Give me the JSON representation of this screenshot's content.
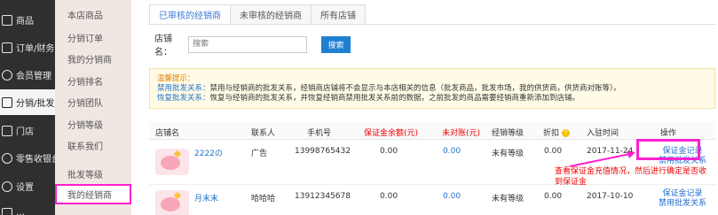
{
  "left_nav": [
    {
      "label": "商品",
      "icon": "shopping-bag-icon"
    },
    {
      "label": "订单/财务",
      "icon": "document-icon"
    },
    {
      "label": "会员管理",
      "icon": "user-icon"
    },
    {
      "label": "分销/批发",
      "icon": "distribute-icon",
      "active": true
    },
    {
      "label": "门店",
      "icon": "store-icon"
    },
    {
      "label": "零售收银台",
      "icon": "cashier-icon"
    },
    {
      "label": "设置",
      "icon": "gear-icon"
    },
    {
      "label": "…",
      "icon": "more-icon"
    }
  ],
  "sub_nav": [
    "本店商品",
    "分销订单",
    "我的分销商",
    "分销排名",
    "分销团队",
    "分销等级",
    "联系我们",
    "批发等级",
    "我的经销商"
  ],
  "tabs": [
    "已审核的经销商",
    "未审核的经销商",
    "所有店铺"
  ],
  "search": {
    "label": "店铺名：",
    "placeholder": "搜索",
    "button": "搜索"
  },
  "tip": {
    "title": "温馨提示：",
    "line1_key": "禁用批发关系：",
    "line1_text": "禁用与经销商的批发关系，经销商店铺将不会显示与本店相关的信息（批发商品，批发市场，我的供货商，供货商对账等）。",
    "line2_key": "恢复批发关系：",
    "line2_text": "恢复与经销商的批发关系，并恢复经销商禁用批发关系前的数据，之前批发的商品需要经销商重新添加到店铺。"
  },
  "table": {
    "headers": [
      "店铺名",
      "联系人",
      "手机号",
      "保证金余额(元)",
      "未对账(元)",
      "经销等级",
      "折扣",
      "入驻时间",
      "操作"
    ],
    "rows": [
      {
        "shop": "2222の",
        "contact": "广告",
        "phone": "13998765432",
        "deposit": "0.00",
        "unreconciled": "0.00",
        "level": "未有等级",
        "discount": "0.00",
        "date": "2017-11-24",
        "op1": "保证金记录",
        "op2": "禁用批发关系"
      },
      {
        "shop": "月末末",
        "contact": "哈哈哈",
        "phone": "13912345678",
        "deposit": "0.00",
        "unreconciled": "0.00",
        "level": "未有等级",
        "discount": "0.00",
        "date": "2017-10-10",
        "op1": "保证金记录",
        "op2": "禁用批发关系"
      }
    ]
  },
  "annotation": "查看保证金充值情况，然后进行确定是否收到保证金",
  "colors": {
    "highlight": "#ff1fd1",
    "link": "#1f6fcf",
    "primary": "#1f7fd0",
    "warn": "#e00000"
  }
}
